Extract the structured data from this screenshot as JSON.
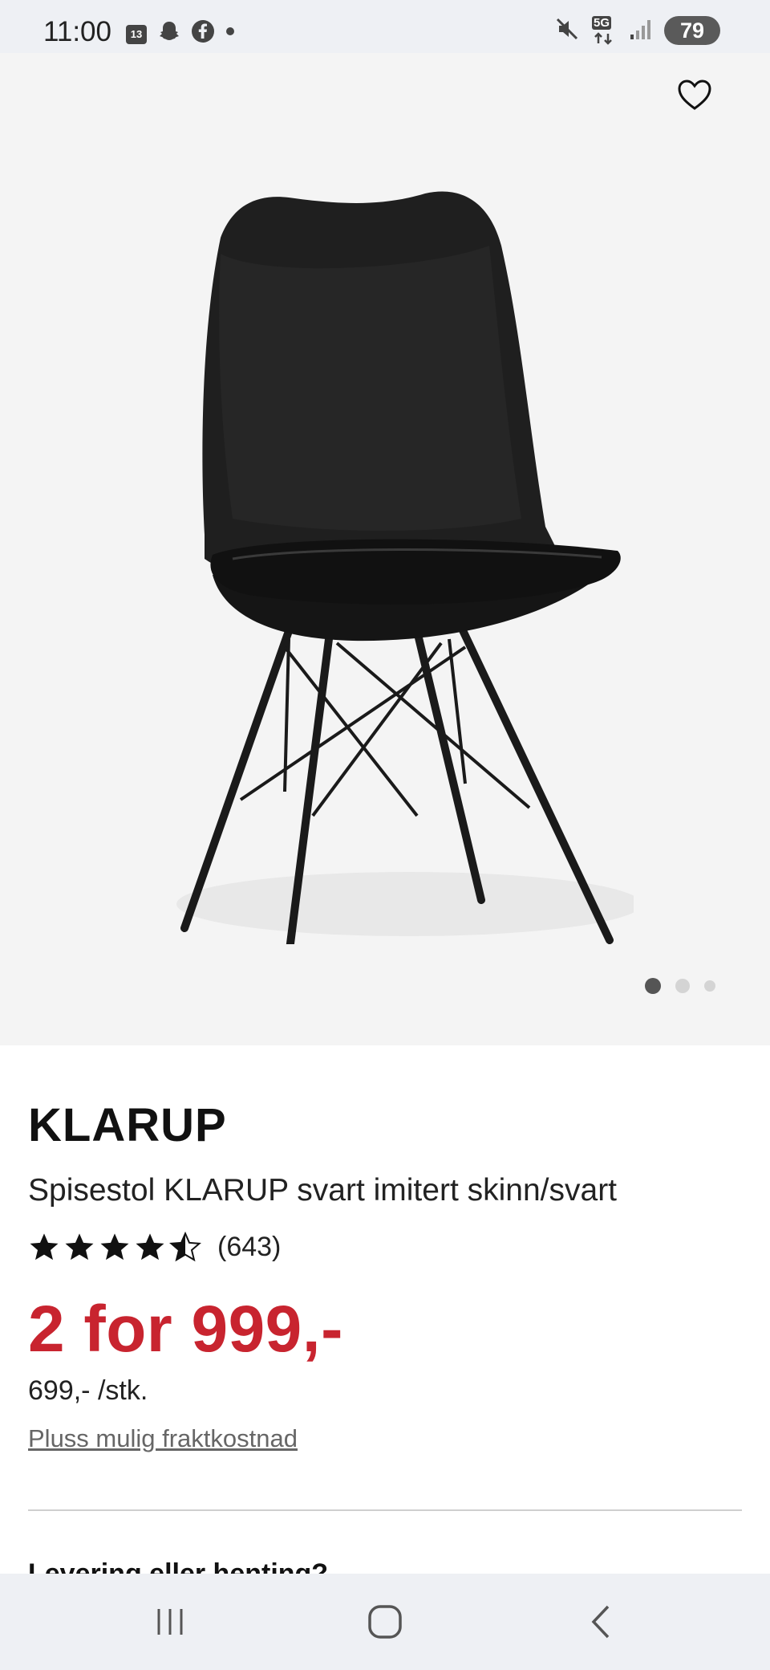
{
  "status_bar": {
    "time": "11:00",
    "calendar_day": "13",
    "network": "5G",
    "battery": "79",
    "left_icons": [
      "calendar-icon",
      "snapchat-icon",
      "facebook-icon",
      "notification-dot-icon"
    ],
    "right_icons": [
      "mute-icon",
      "5g-data-icon",
      "signal-icon"
    ]
  },
  "hero": {
    "product_image": "black-dining-chair-image",
    "favorite_icon": "heart-outline-icon",
    "carousel": {
      "total": 3,
      "active": 1
    }
  },
  "product": {
    "brand": "KLARUP",
    "name": "Spisestol KLARUP svart imitert skinn/svart",
    "rating": 4.5,
    "rating_max": 5,
    "review_count": "(643)",
    "price": "2 for 999,-",
    "unit_price": "699,- /stk.",
    "shipping_link": "Pluss mulig fraktkostnad",
    "accent_color": "#c8242f"
  },
  "next_section": {
    "title": "Levering eller henting?"
  },
  "nav_bar": {
    "buttons": [
      "recent-apps-icon",
      "home-icon",
      "back-icon"
    ]
  }
}
